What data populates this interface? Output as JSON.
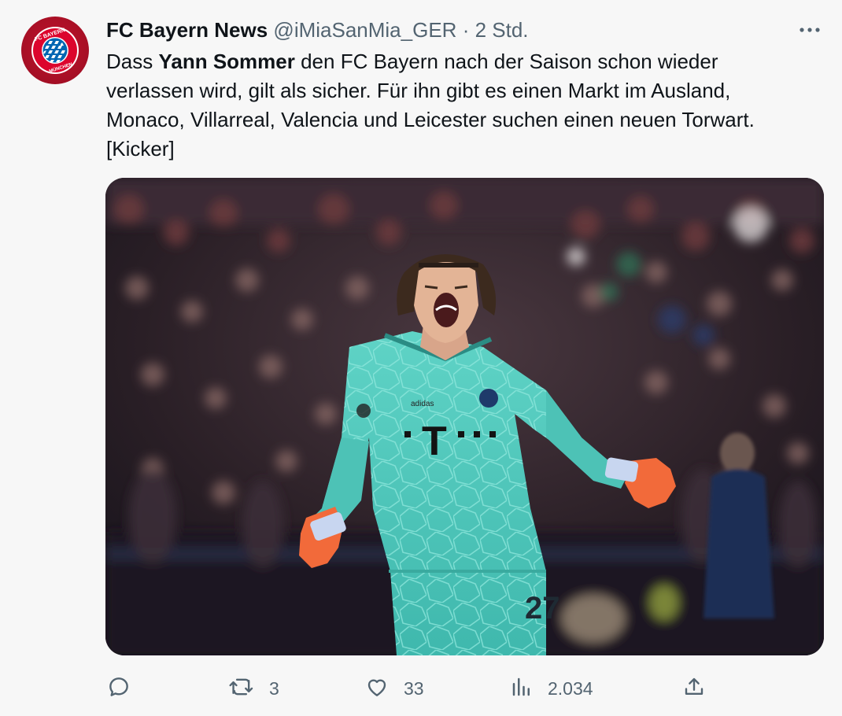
{
  "tweet": {
    "author_name": "FC Bayern News",
    "handle": "@iMiaSanMia_GER",
    "separator": "·",
    "time": "2 Std.",
    "text_part1": "Dass ",
    "text_bold": "Yann Sommer",
    "text_part2": " den FC Bayern nach der Saison schon wieder verlassen wird, gilt als sicher. Für ihn gibt es einen Markt im Ausland, Monaco, Villarreal, Valencia und Leicester suchen einen neuen Torwart. [Kicker]",
    "avatar_logo_text_top": "FC BAYERN",
    "avatar_logo_text_bottom": "MÜNCHEN",
    "jersey_sponsor": "T",
    "jersey_number": "27",
    "kit_brand": "adidas"
  },
  "actions": {
    "reply_icon": "reply-icon",
    "retweet_icon": "retweet-icon",
    "retweet_count": "3",
    "like_icon": "heart-icon",
    "like_count": "33",
    "views_icon": "views-chart-icon",
    "views_count": "2.034",
    "share_icon": "share-icon"
  },
  "colors": {
    "text_primary": "#0f1419",
    "text_secondary": "#536471",
    "background": "#f7f7f7",
    "bayern_red": "#dc052d",
    "jersey_teal": "#4fc8bd",
    "glove_orange": "#f26a3a"
  }
}
